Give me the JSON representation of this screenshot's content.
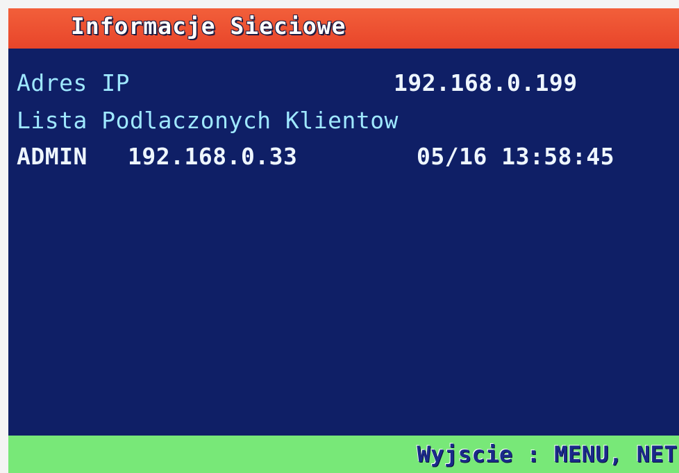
{
  "header": {
    "title": "Informacje Sieciowe"
  },
  "network": {
    "ip_label": "Adres IP",
    "ip_value": "192.168.0.199",
    "clients_heading": "Lista Podlaczonych Klientow",
    "clients": [
      {
        "user": "ADMIN",
        "ip": "192.168.0.33",
        "timestamp": "05/16 13:58:45"
      }
    ]
  },
  "footer": {
    "hint": "Wyjscie : MENU, NET"
  },
  "colors": {
    "title_bar": "#e8452a",
    "background": "#0f1f66",
    "label_text": "#9fe8ff",
    "value_text": "#eef6ff",
    "footer_bar": "#78e878",
    "footer_text": "#1a2a8a"
  }
}
